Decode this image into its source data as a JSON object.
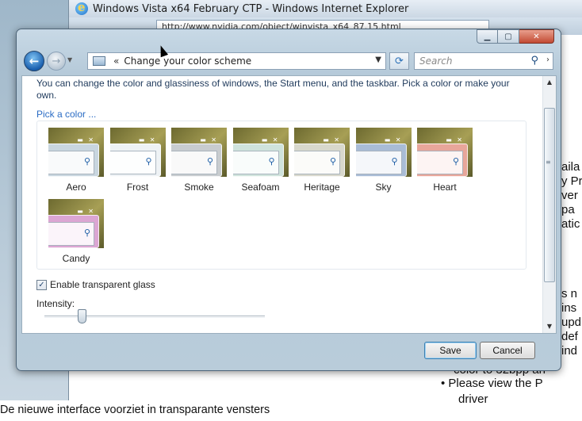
{
  "background_browser": {
    "title": "Windows Vista x64 February CTP - Windows Internet Explorer",
    "url": "http://www.nvidia.com/object/winvista_x64_87.15.html",
    "text_fragments": [
      "aila",
      "y Pr",
      "ver",
      "pa",
      "atic",
      "s n",
      "ins",
      "upd",
      "def",
      "ind"
    ],
    "bullet_text": "Please view the P",
    "bullet_under": "driver",
    "fragment_under_dialog": "color to 32bpp an"
  },
  "dialog": {
    "address": "Change your color scheme",
    "address_chevron": "«",
    "search_placeholder": "Search",
    "intro": "You can change the color and glassiness of windows, the Start menu, and the taskbar. Pick a color or make your own.",
    "pick_color_link": "Pick a color ...",
    "colors": [
      {
        "name": "Aero",
        "hex": "#c9d6df"
      },
      {
        "name": "Frost",
        "hex": "#eef2f5"
      },
      {
        "name": "Smoke",
        "hex": "#c8cccf"
      },
      {
        "name": "Seafoam",
        "hex": "#cfe3dc"
      },
      {
        "name": "Heritage",
        "hex": "#d8d8cc"
      },
      {
        "name": "Sky",
        "hex": "#a9bcd6"
      },
      {
        "name": "Heart",
        "hex": "#e8a69a"
      },
      {
        "name": "Candy",
        "hex": "#dca6d3"
      }
    ],
    "enable_glass_label": "Enable transparent glass",
    "enable_glass_checked": true,
    "intensity_label": "Intensity:",
    "intensity_value": 0.17,
    "save_label": "Save",
    "cancel_label": "Cancel"
  },
  "caption": "De nieuwe interface voorziet in transparante vensters"
}
